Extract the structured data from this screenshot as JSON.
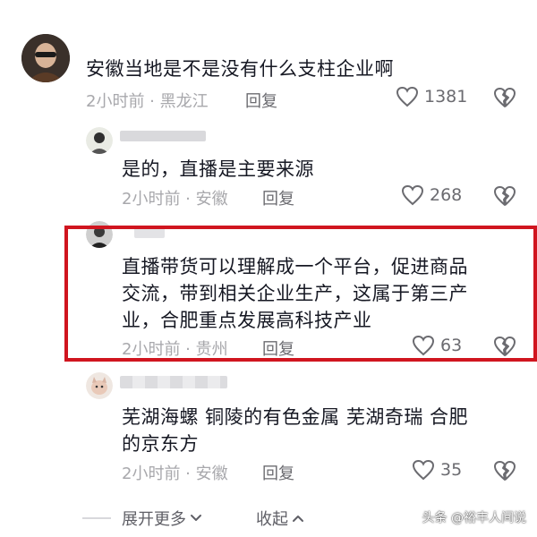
{
  "comments": [
    {
      "text_lines": [
        "安徽当地是不是没有什么支柱企业啊"
      ],
      "time": "2小时前",
      "location": "黑龙江",
      "reply_label": "回复",
      "likes": "1381"
    },
    {
      "text_lines": [
        "是的，直播是主要来源"
      ],
      "time": "2小时前",
      "location": "安徽",
      "reply_label": "回复",
      "likes": "268"
    },
    {
      "text_lines": [
        "直播带货可以理解成一个平台，促进商品",
        "交流，带到相关企业生产，这属于第三产",
        "业，合肥重点发展高科技产业"
      ],
      "time": "2小时前",
      "location": "贵州",
      "reply_label": "回复",
      "likes": "63"
    },
    {
      "text_lines": [
        "芜湖海螺 铜陵的有色金属  芜湖奇瑞  合肥",
        "的京东方"
      ],
      "time": "2小时前",
      "location": "安徽",
      "reply_label": "回复",
      "likes": "35"
    }
  ],
  "footer": {
    "expand_label": "展开更多",
    "collapse_label": "收起"
  },
  "watermark": "头条 @裕丰人间说",
  "colors": {
    "highlight_border": "#d0151f",
    "meta_text": "#a8a8ac",
    "icon_gray": "#6b6b70"
  },
  "icons": [
    "heart-icon",
    "broken-heart-icon",
    "chevron-down-icon",
    "chevron-up-icon"
  ]
}
